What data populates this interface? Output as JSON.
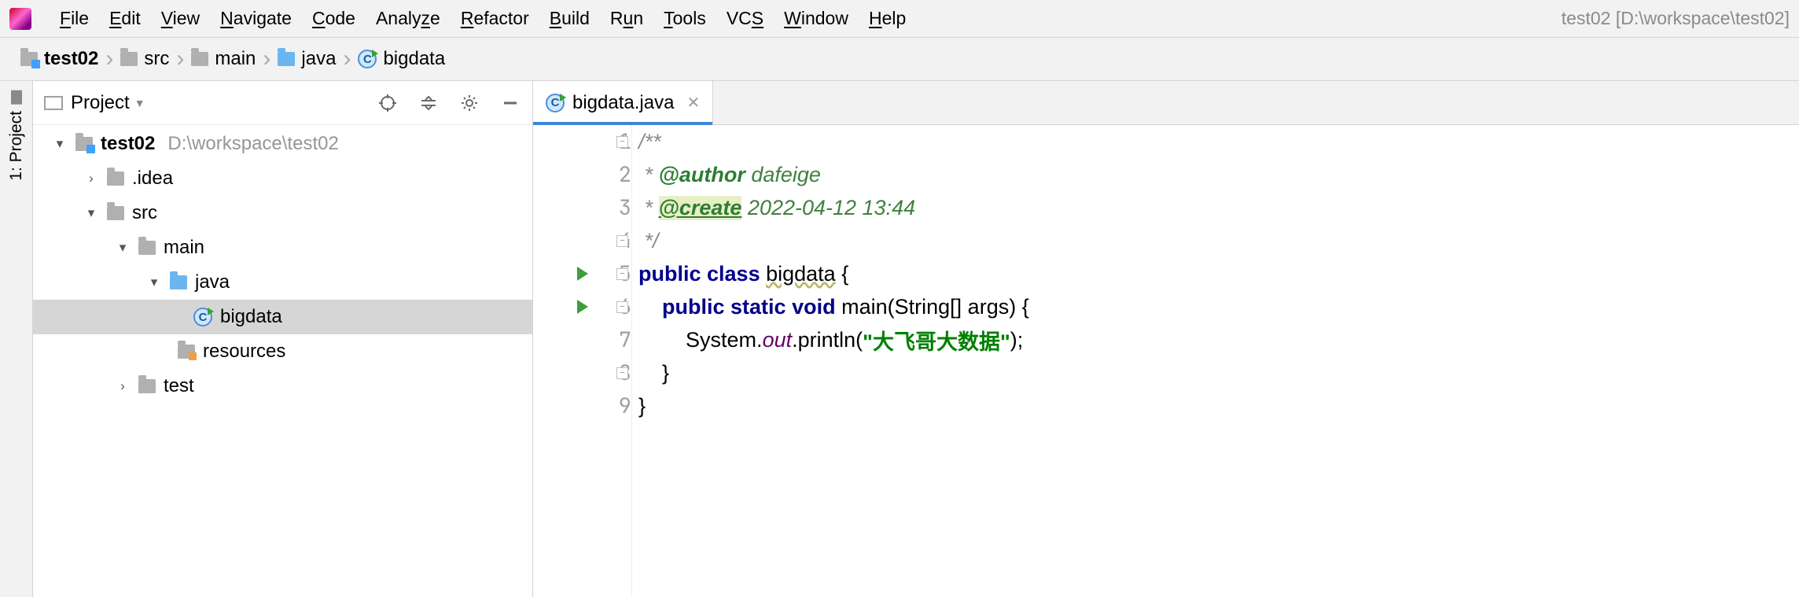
{
  "app": {
    "title_hint": "test02 [D:\\workspace\\test02]"
  },
  "menu": {
    "file": "File",
    "edit": "Edit",
    "view": "View",
    "navigate": "Navigate",
    "code": "Code",
    "analyze": "Analyze",
    "refactor": "Refactor",
    "build": "Build",
    "run": "Run",
    "tools": "Tools",
    "vcs": "VCS",
    "window": "Window",
    "help": "Help"
  },
  "breadcrumb": {
    "items": [
      {
        "label": "test02",
        "kind": "module",
        "bold": true
      },
      {
        "label": "src",
        "kind": "folder"
      },
      {
        "label": "main",
        "kind": "folder"
      },
      {
        "label": "java",
        "kind": "source"
      },
      {
        "label": "bigdata",
        "kind": "class"
      }
    ]
  },
  "sidebar": {
    "project_tab": "1: Project"
  },
  "project_panel": {
    "title": "Project"
  },
  "tree": {
    "root_label": "test02",
    "root_hint": "D:\\workspace\\test02",
    "idea": ".idea",
    "src": "src",
    "main": "main",
    "java": "java",
    "bigdata": "bigdata",
    "resources": "resources",
    "test": "test"
  },
  "editor": {
    "tab_label": "bigdata.java",
    "lines": {
      "l1": "1",
      "l2": "2",
      "l3": "3",
      "l4": "4",
      "l5": "5",
      "l6": "6",
      "l7": "7",
      "l8": "8",
      "l9": "9"
    },
    "code": {
      "doc_open": "/**",
      "author_tag": "@author",
      "author_val": "dafeige",
      "create_tag": "@create",
      "create_val": "2022-04-12 13:44",
      "doc_close": " */",
      "kw_public": "public",
      "kw_class": "class",
      "classname": "bigdata",
      "kw_static": "static",
      "kw_void": "void",
      "main_name": "main",
      "main_params": "(String[] args)",
      "sys": "System",
      "out": "out",
      "println": "println",
      "str": "\"大飞哥大数据\""
    }
  }
}
